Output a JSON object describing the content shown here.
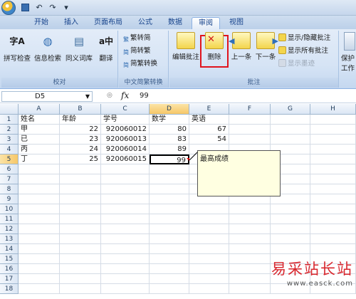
{
  "quick_access": {
    "icons": [
      "office-button-icon",
      "save-icon",
      "undo-icon",
      "redo-icon",
      "customize-qat-icon"
    ]
  },
  "tabs": [
    {
      "label": "开始",
      "active": false
    },
    {
      "label": "插入",
      "active": false
    },
    {
      "label": "页面布局",
      "active": false
    },
    {
      "label": "公式",
      "active": false
    },
    {
      "label": "数据",
      "active": false
    },
    {
      "label": "审阅",
      "active": true
    },
    {
      "label": "视图",
      "active": false
    }
  ],
  "ribbon": {
    "proofing": {
      "label": "校对",
      "buttons": [
        "拼写检查",
        "信息检索",
        "同义词库",
        "翻译"
      ],
      "icon_glyphs": [
        "字A",
        "◍",
        "▤",
        "a中"
      ]
    },
    "chinese": {
      "label": "中文简繁转换",
      "buttons": [
        "繁转简",
        "简转繁",
        "简繁转换"
      ],
      "icon_glyphs": [
        "繁",
        "简",
        "简"
      ]
    },
    "comments": {
      "label": "批注",
      "edit": "编辑批注",
      "delete": "删除",
      "previous": "上一条",
      "next": "下一条",
      "show_hide": "显示/隐藏批注",
      "show_all": "显示所有批注",
      "show_ink": "显示墨迹"
    },
    "protect": {
      "partial_labels": [
        "保护",
        "工作"
      ]
    }
  },
  "formula_bar": {
    "name_box": "D5",
    "fx": "fx",
    "value": "99",
    "separator": "◎"
  },
  "sheet": {
    "columns": [
      "A",
      "B",
      "C",
      "D",
      "E",
      "F",
      "G",
      "H"
    ],
    "rows": [
      "1",
      "2",
      "3",
      "4",
      "5",
      "6",
      "7",
      "8",
      "9",
      "10",
      "11",
      "12",
      "13",
      "14",
      "15",
      "16",
      "17",
      "18"
    ],
    "header_row": [
      "姓名",
      "年龄",
      "学号",
      "数学",
      "英语"
    ],
    "data": [
      [
        "甲",
        "22",
        "920060012",
        "80",
        "67"
      ],
      [
        "已",
        "23",
        "920060013",
        "83",
        "54"
      ],
      [
        "丙",
        "24",
        "920060014",
        "89",
        ""
      ],
      [
        "丁",
        "25",
        "920060015",
        "99",
        ""
      ]
    ],
    "active_cell": "D5",
    "comment": "最高成绩"
  },
  "watermark": {
    "text": "易采站长站",
    "url": "www.easck.com"
  },
  "colors": {
    "delete_highlight": "#e0141d",
    "comment_bg": "#ffffe1",
    "watermark": "#d8272e"
  }
}
